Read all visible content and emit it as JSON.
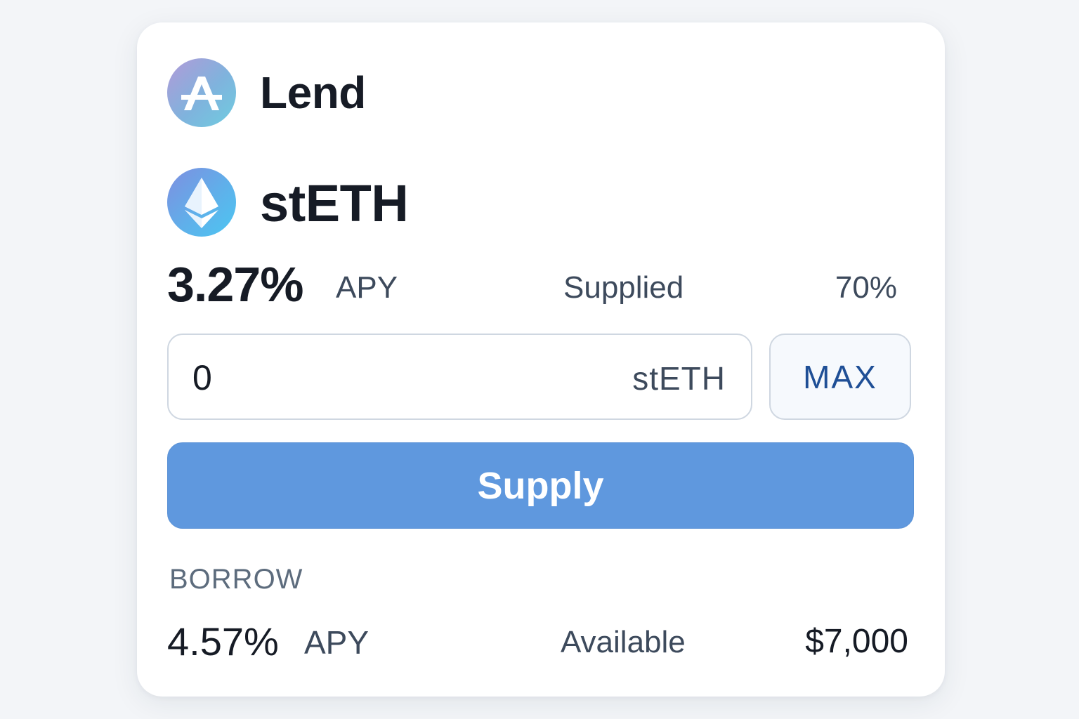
{
  "header": {
    "app_title": "Lend",
    "app_logo_icon": "aave-logo-icon",
    "logo_letter": "A"
  },
  "asset": {
    "name": "stETH",
    "icon": "ethereum-icon"
  },
  "supply": {
    "apy_value": "3.27%",
    "apy_unit": "APY",
    "supplied_label": "Supplied",
    "supplied_value": "70%",
    "amount_value": "0",
    "amount_unit": "stETH",
    "max_label": "MAX",
    "button_label": "Supply"
  },
  "borrow": {
    "heading": "BORROW",
    "apy_value": "4.57%",
    "apy_unit": "APY",
    "available_label": "Available",
    "available_value": "$7,000"
  },
  "colors": {
    "page_background": "#f3f5f8",
    "card_background": "#ffffff",
    "primary_button": "#5f98de",
    "max_text": "#1f4f96",
    "text_primary": "#161b25",
    "text_secondary": "#3d4a5c"
  }
}
